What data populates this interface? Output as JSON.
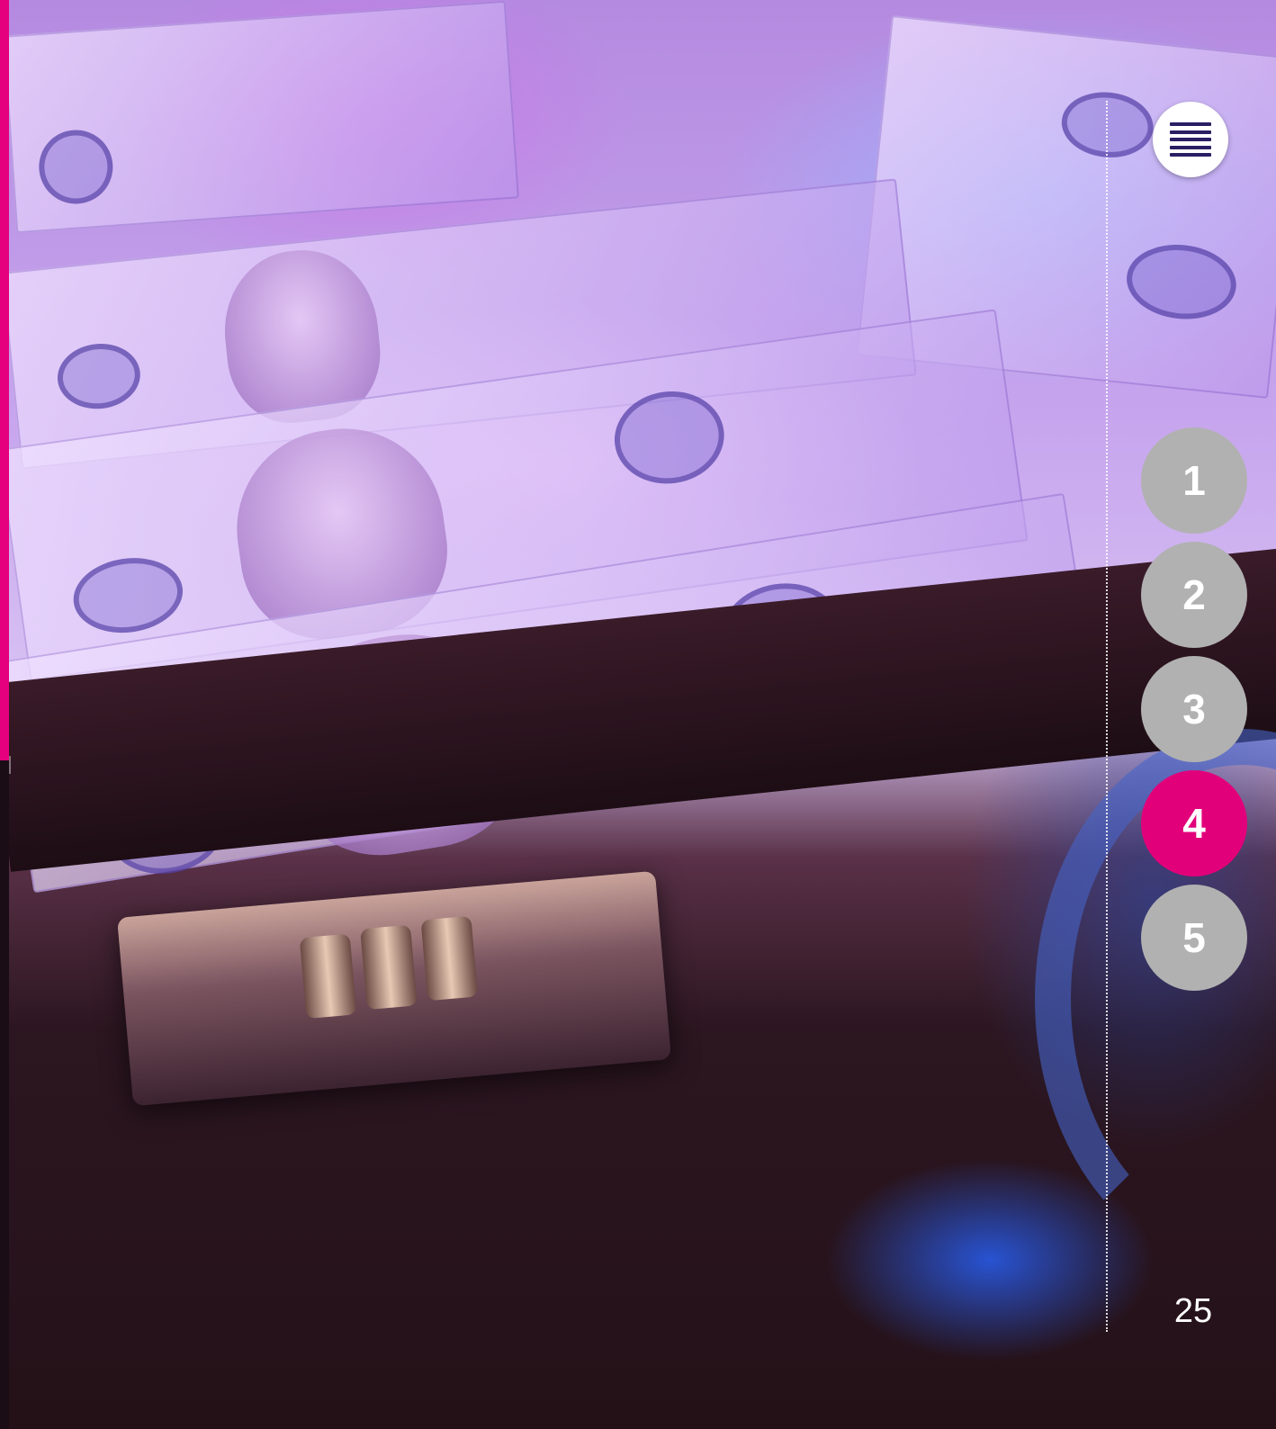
{
  "menu": {
    "icon": "hamburger-menu-icon"
  },
  "chapters": [
    {
      "label": "1",
      "active": false
    },
    {
      "label": "2",
      "active": false
    },
    {
      "label": "3",
      "active": false
    },
    {
      "label": "4",
      "active": true
    },
    {
      "label": "5",
      "active": false
    }
  ],
  "page": {
    "number": "25"
  },
  "colors": {
    "accent": "#e2007a",
    "chapter_inactive": "#b1b1b1",
    "menu_icon": "#2a1f63"
  }
}
